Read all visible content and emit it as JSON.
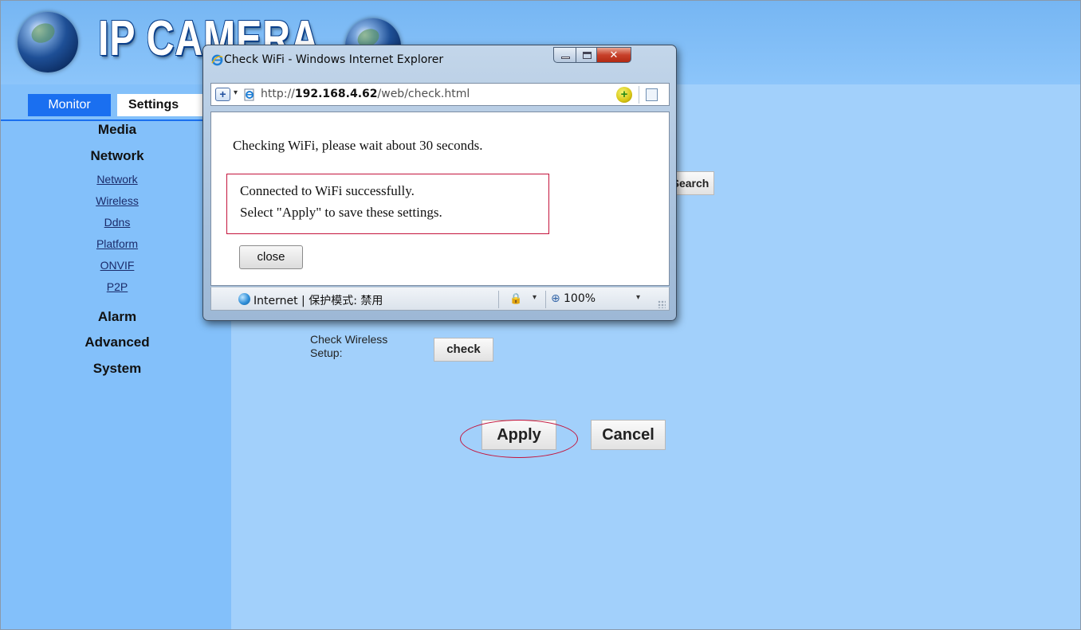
{
  "header": {
    "logo_text": "IP CAMERA"
  },
  "sidebar": {
    "tabs": {
      "monitor": "Monitor",
      "settings": "Settings"
    },
    "sections": {
      "media": "Media",
      "network": "Network",
      "alarm": "Alarm",
      "advanced": "Advanced",
      "system": "System"
    },
    "network_links": [
      "Network",
      "Wireless",
      "Ddns",
      "Platform",
      "ONVIF",
      "P2P"
    ]
  },
  "main": {
    "search_button": "Search",
    "check_label": "Check Wireless Setup:",
    "check_button": "check",
    "apply_button": "Apply",
    "cancel_button": "Cancel"
  },
  "popup": {
    "title": "Check WiFi - Windows Internet Explorer",
    "url_prefix": "http://",
    "url_host": "192.168.4.62",
    "url_path": "/web/check.html",
    "message": "Checking WiFi, please wait about 30 seconds.",
    "result_line1": "Connected to WiFi successfully.",
    "result_line2": "Select \"Apply\" to save these settings.",
    "close_button": "close",
    "status_text": "Internet | 保护模式: 禁用",
    "zoom": "100%"
  }
}
